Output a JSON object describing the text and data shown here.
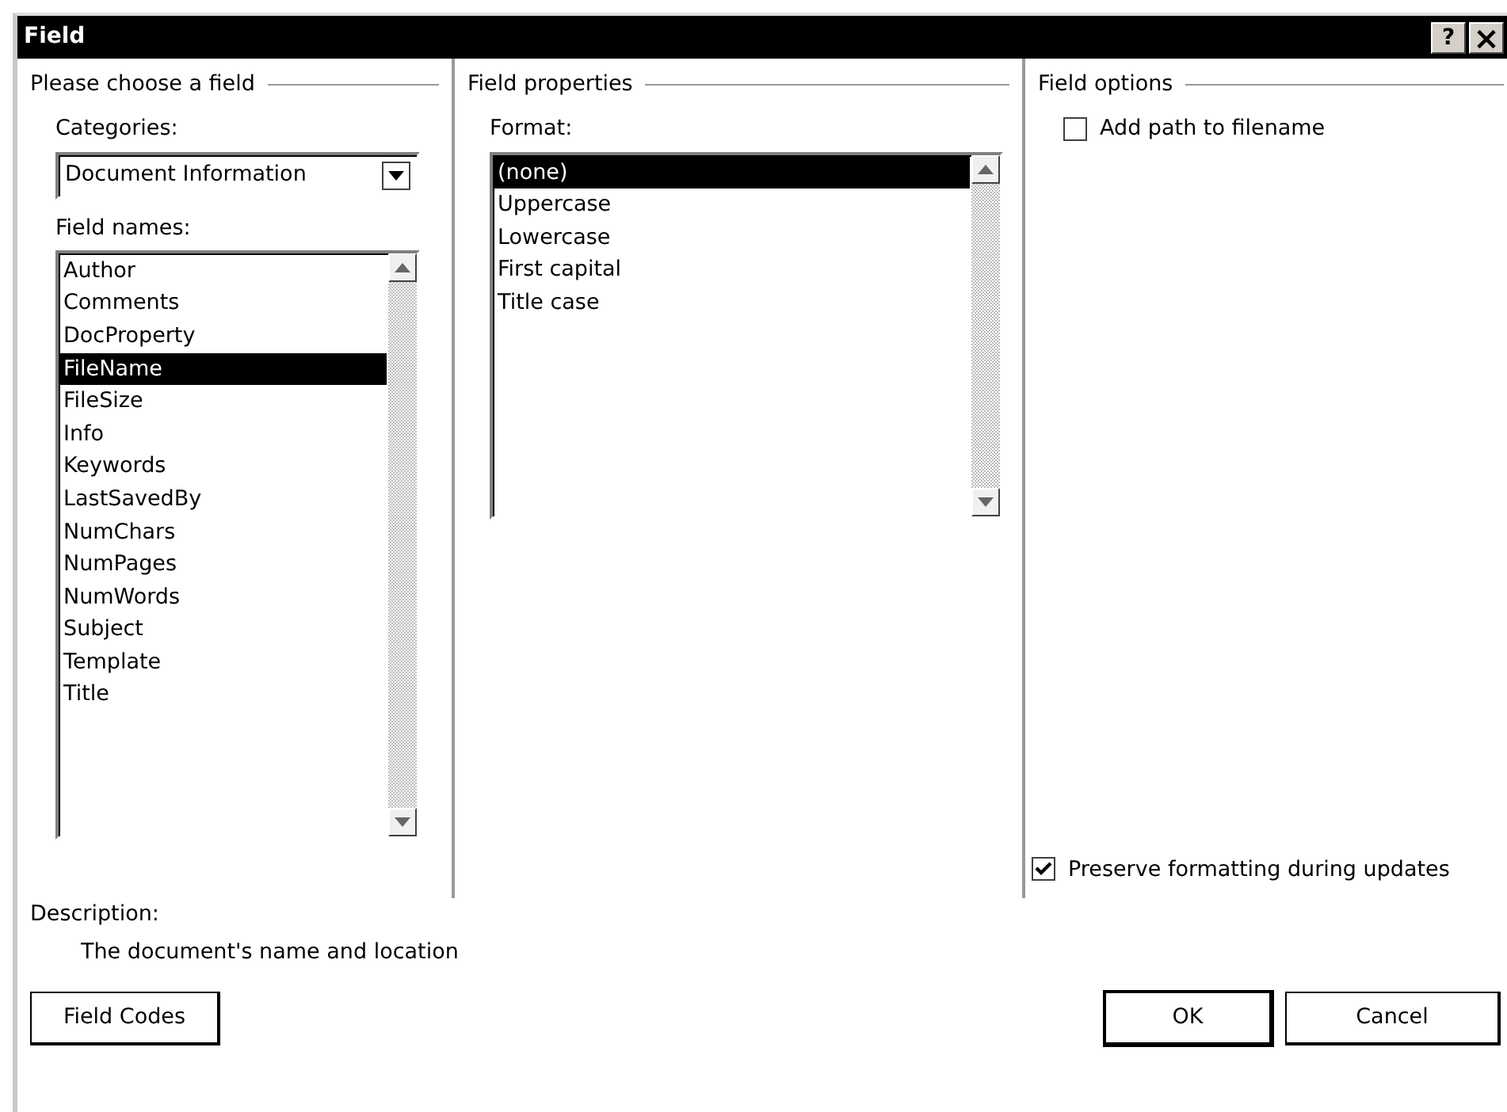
{
  "window": {
    "title": "Field",
    "buttons": [
      {
        "kind": "help",
        "label": "?"
      },
      {
        "kind": "close",
        "label": "×"
      }
    ]
  },
  "choose_panel": {
    "title": "Please choose a field",
    "categories": {
      "label": "Categories:",
      "value": "Document Information"
    },
    "field_names": {
      "label": "Field names:",
      "items": [
        {
          "text": "Author",
          "selected": false
        },
        {
          "text": "Comments",
          "selected": false
        },
        {
          "text": "DocProperty",
          "selected": false
        },
        {
          "text": "FileName",
          "selected": true
        },
        {
          "text": "FileSize",
          "selected": false
        },
        {
          "text": "Info",
          "selected": false
        },
        {
          "text": "Keywords",
          "selected": false
        },
        {
          "text": "LastSavedBy",
          "selected": false
        },
        {
          "text": "NumChars",
          "selected": false
        },
        {
          "text": "NumPages",
          "selected": false
        },
        {
          "text": "NumWords",
          "selected": false
        },
        {
          "text": "Subject",
          "selected": false
        },
        {
          "text": "Template",
          "selected": false
        },
        {
          "text": "Title",
          "selected": false
        }
      ]
    }
  },
  "properties_panel": {
    "title": "Field properties",
    "format": {
      "label": "Format:",
      "items": [
        {
          "text": "(none)",
          "selected": true
        },
        {
          "text": "Uppercase",
          "selected": false
        },
        {
          "text": "Lowercase",
          "selected": false
        },
        {
          "text": "First capital",
          "selected": false
        },
        {
          "text": "Title case",
          "selected": false
        }
      ]
    }
  },
  "options_panel": {
    "title": "Field options",
    "add_path": {
      "label": "Add path to filename",
      "checked": false
    },
    "preserve": {
      "label": "Preserve formatting during updates",
      "checked": true
    }
  },
  "description": {
    "label": "Description:",
    "text": "The document's name and location"
  },
  "buttons": [
    {
      "label": "Field Codes",
      "default": false
    },
    {
      "label": "OK",
      "default": true
    },
    {
      "label": "Cancel",
      "default": false
    }
  ]
}
